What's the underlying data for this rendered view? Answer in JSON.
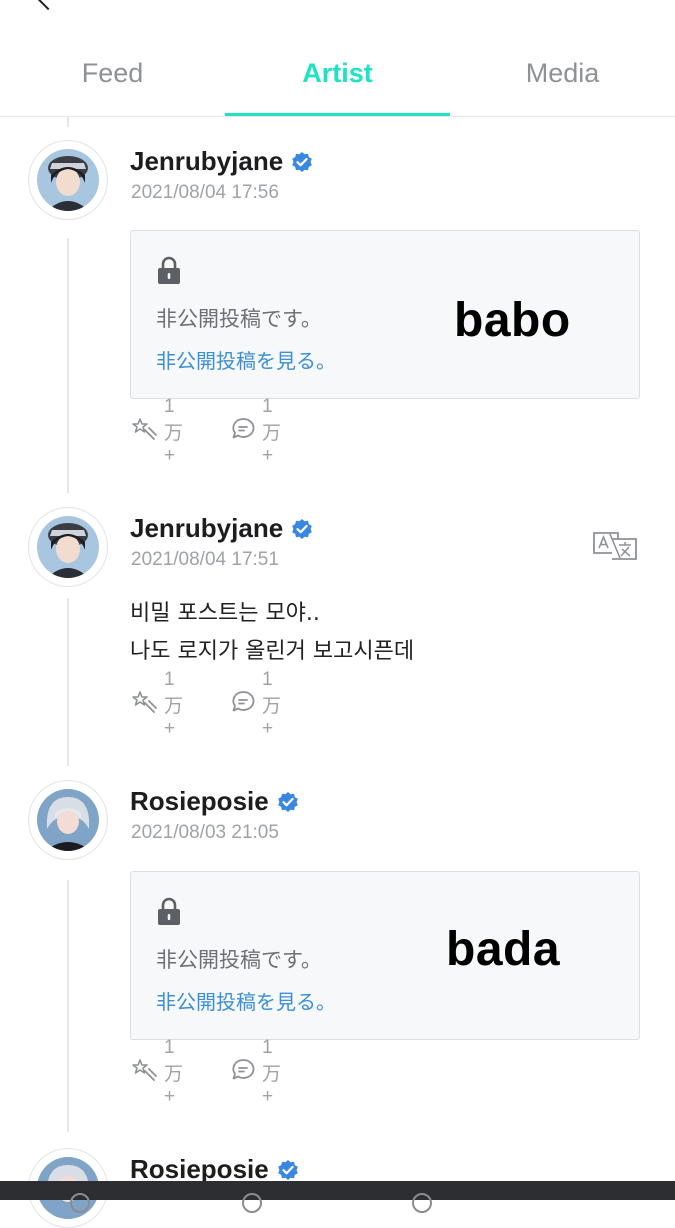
{
  "tabs": [
    {
      "label": "Feed"
    },
    {
      "label": "Artist",
      "active": true
    },
    {
      "label": "Media"
    }
  ],
  "accent_color": "#1ee3c3",
  "posts": [
    {
      "author": "Jenrubyjane",
      "verified": true,
      "timestamp": "2021/08/04 17:56",
      "type": "locked",
      "locked_message": "非公開投稿です。",
      "locked_link": "非公開投稿を見る。",
      "sticker": "babo",
      "likes": "1万+",
      "comments": "1万+"
    },
    {
      "author": "Jenrubyjane",
      "verified": true,
      "timestamp": "2021/08/04 17:51",
      "type": "text",
      "text_lines": [
        "비밀 포스트는 모야..",
        "나도 로지가 올린거 보고시픈데"
      ],
      "likes": "1万+",
      "comments": "1万+"
    },
    {
      "author": "Rosieposie",
      "verified": true,
      "timestamp": "2021/08/03 21:05",
      "type": "locked",
      "locked_message": "非公開投稿です。",
      "locked_link": "非公開投稿を見る。",
      "sticker": "bada",
      "likes": "1万+",
      "comments": "1万+"
    },
    {
      "author": "Rosieposie",
      "verified": true
    }
  ]
}
